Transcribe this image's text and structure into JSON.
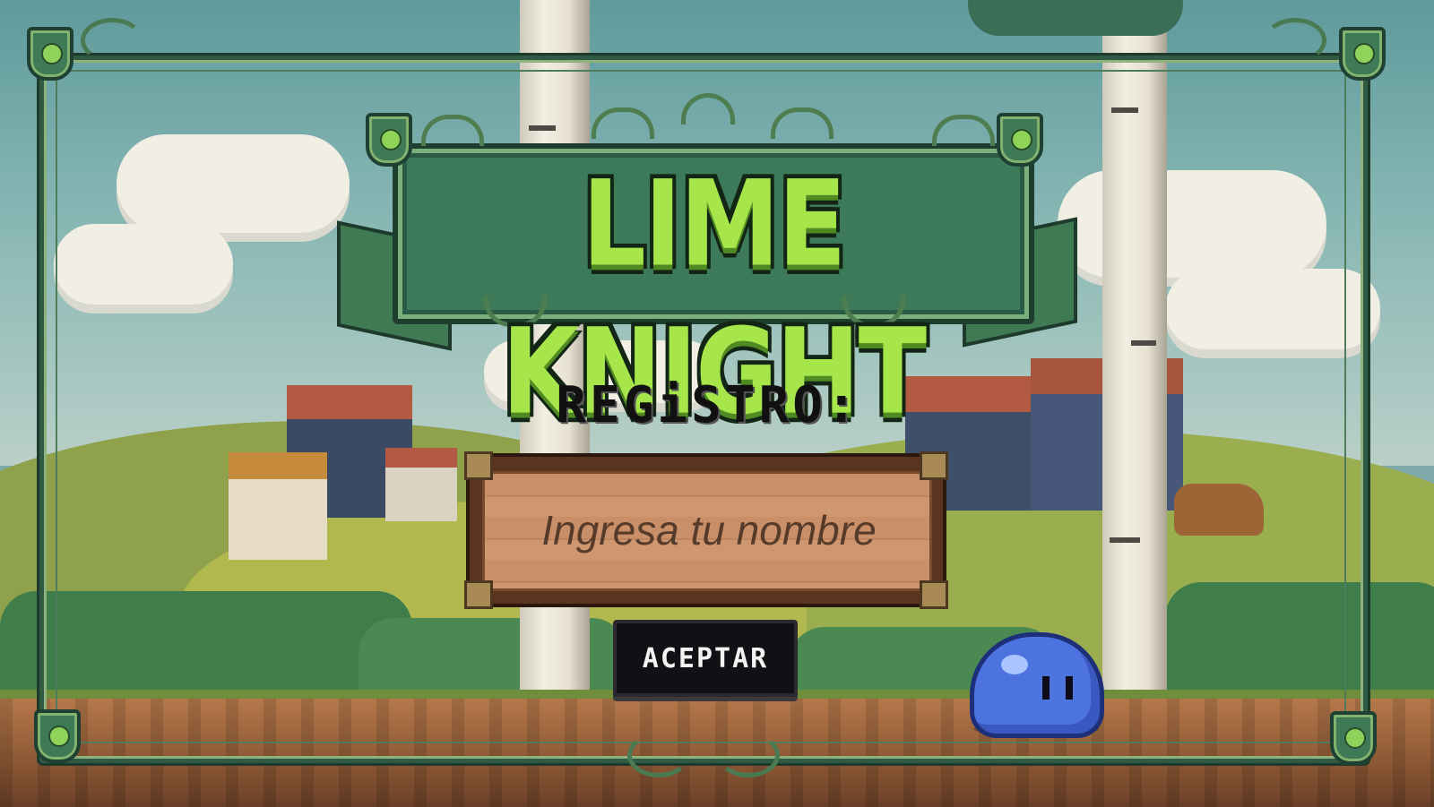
{
  "game": {
    "title": "LIME KNIGHT",
    "screen": "registration"
  },
  "registration": {
    "label": "REGiSTRO:",
    "name_placeholder": "Ingresa tu nombre",
    "name_value": "",
    "accept_label": "ACEPTAR"
  },
  "colors": {
    "title_green": "#a6e64a",
    "frame_green": "#2f5b45",
    "board_wood": "#c98f68",
    "button_bg": "#111014",
    "slime_blue": "#4d73e0"
  },
  "icons": {
    "corner_ornaments": "shield-icon",
    "mascot": "slime-icon"
  }
}
